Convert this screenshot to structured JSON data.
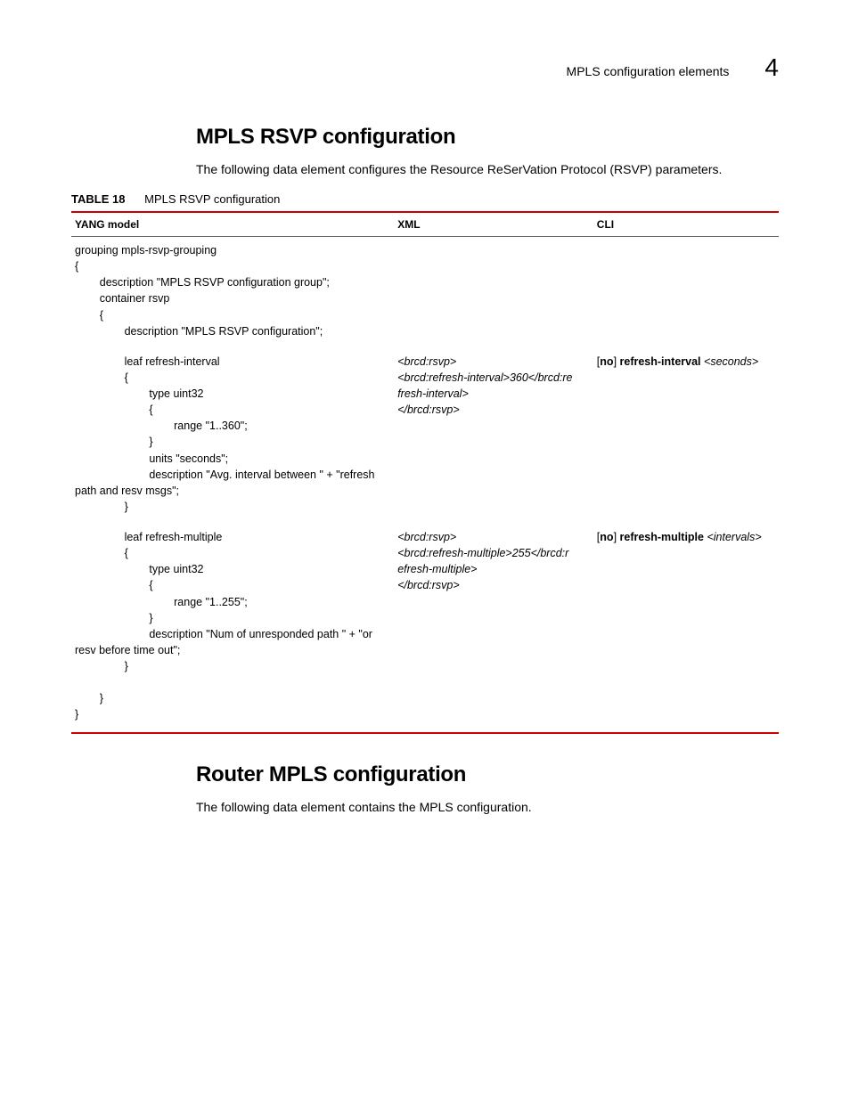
{
  "header": {
    "text": "MPLS configuration elements",
    "chapter": "4"
  },
  "section1": {
    "title": "MPLS RSVP configuration",
    "intro": "The following data element configures the Resource ReSerVation Protocol (RSVP) parameters.",
    "table_label": "TABLE 18",
    "table_caption": "MPLS RSVP configuration",
    "cols": {
      "yang": "YANG model",
      "xml": "XML",
      "cli": "CLI"
    },
    "row1": {
      "yang": "grouping mpls-rsvp-grouping\n{\n        description \"MPLS RSVP configuration group\";\n        container rsvp\n        {\n                description \"MPLS RSVP configuration\";"
    },
    "row2": {
      "yang": "                leaf refresh-interval\n                {\n                        type uint32\n                        {\n                                range \"1..360\";\n                        }\n                        units \"seconds\";\n                        description \"Avg. interval between \" + \"refresh\npath and resv msgs\";\n                }",
      "xml_l1": "<brcd:rsvp>",
      "xml_l2": "<brcd:refresh-interval>360</brcd:re",
      "xml_l3": "fresh-interval>",
      "xml_l4": "</brcd:rsvp>",
      "cli_pre": "[",
      "cli_no": "no",
      "cli_post1": "] ",
      "cli_cmd": "refresh-interval",
      "cli_post2": " ",
      "cli_lt": "<",
      "cli_arg": "seconds",
      "cli_gt": ">"
    },
    "row3": {
      "yang": "                leaf refresh-multiple\n                {\n                        type uint32\n                        {\n                                range \"1..255\";\n                        }\n                        description \"Num of unresponded path \" + \"or\nresv before time out\";\n                }\n\n        }\n}",
      "xml_l1": "<brcd:rsvp>",
      "xml_l2": "<brcd:refresh-multiple>255</brcd:r",
      "xml_l3": "efresh-multiple>",
      "xml_l4": "</brcd:rsvp>",
      "cli_pre": "[",
      "cli_no": "no",
      "cli_post1": "] ",
      "cli_cmd": "refresh-multiple",
      "cli_post2": " ",
      "cli_lt": "<",
      "cli_arg": "intervals",
      "cli_gt": ">"
    }
  },
  "section2": {
    "title": "Router MPLS configuration",
    "intro": "The following data element contains the MPLS configuration."
  }
}
